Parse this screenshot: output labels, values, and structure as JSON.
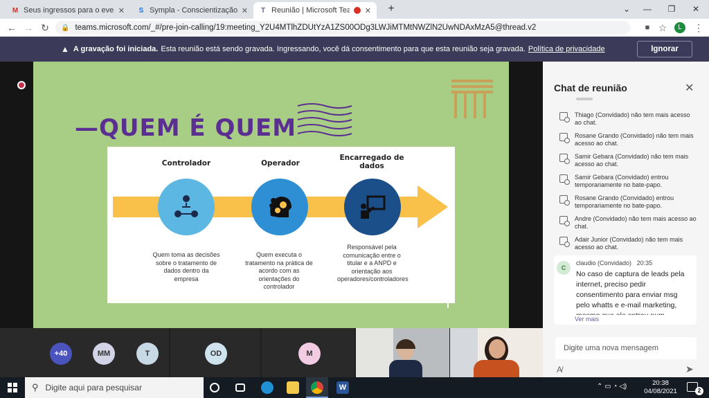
{
  "browser": {
    "tabs": [
      {
        "title": "Seus ingressos para o evento: Co",
        "icon": "gmail-icon"
      },
      {
        "title": "Sympla - Conscientização da LGP",
        "icon": "sympla-icon"
      },
      {
        "title": "Reunião | Microsoft Teams",
        "icon": "teams-icon"
      }
    ],
    "url": "teams.microsoft.com/_#/pre-join-calling/19:meeting_Y2U4MTlhZDUtYzA1ZS00ODg3LWJiMTMtNWZlN2UwNDAxMzA5@thread.v2",
    "profile_initial": "L"
  },
  "banner": {
    "bold": "A gravação foi iniciada.",
    "text": "Esta reunião está sendo gravada. Ingressando, você dá consentimento para que esta reunião seja gravada.",
    "link": "Política de privacidade",
    "button": "Ignorar"
  },
  "slide": {
    "title": "—QUEM É QUEM",
    "columns": [
      {
        "heading": "Controlador",
        "description": "Quem toma as decisões sobre o tratamento de dados dentro da empresa"
      },
      {
        "heading": "Operador",
        "description": "Quem executa o tratamento na prática de acordo com as orientações do controlador"
      },
      {
        "heading": "Encarregado de dados",
        "description": "Responsável pela comunicação entre o titular e a ANPD e orientação aos operadores/controladores"
      }
    ]
  },
  "participants": [
    {
      "label": "+40",
      "color": "#4b53bc"
    },
    {
      "label": "MM",
      "color": "#d3d3e8"
    },
    {
      "label": "T",
      "color": "#c8d9e6"
    },
    {
      "label": "OD",
      "color": "#cfe3ef"
    },
    {
      "label": "M",
      "color": "#f2cce3"
    }
  ],
  "chat": {
    "title": "Chat de reunião",
    "events": [
      "Thiago (Convidado) não tem mais acesso ao chat.",
      "Rosane Grando (Convidado) não tem mais acesso ao chat.",
      "Samir Gebara (Convidado) não tem mais acesso ao chat.",
      "Samir Gebara (Convidado) entrou temporariamente no bate-papo.",
      "Rosane Grando (Convidado) entrou temporariamente no bate-papo.",
      "Andre (Convidado) não tem mais acesso ao chat.",
      "Adair Junior (Convidado) não tem mais acesso ao chat."
    ],
    "message": {
      "avatar": "C",
      "author": "claudio (Convidado)",
      "time": "20:35",
      "text": "No caso de captura de leads pela internet, preciso pedir consentimento para enviar msg pelo whatts e e-mail marketing, mesmo que ele entrou num",
      "more": "Ver mais"
    },
    "composer_placeholder": "Digite uma nova mensagem"
  },
  "taskbar": {
    "search_placeholder": "Digite aqui para pesquisar",
    "time": "20:38",
    "date": "04/08/2021",
    "notifications": "2"
  },
  "colors": {
    "teams_purple": "#3b3a58",
    "slide_green": "#a8cd84",
    "title_purple": "#5b2f92",
    "arrow_yellow": "#f9c14a",
    "circle_blue": "#2f8fd4",
    "circle_navy": "#1a4f8a"
  }
}
